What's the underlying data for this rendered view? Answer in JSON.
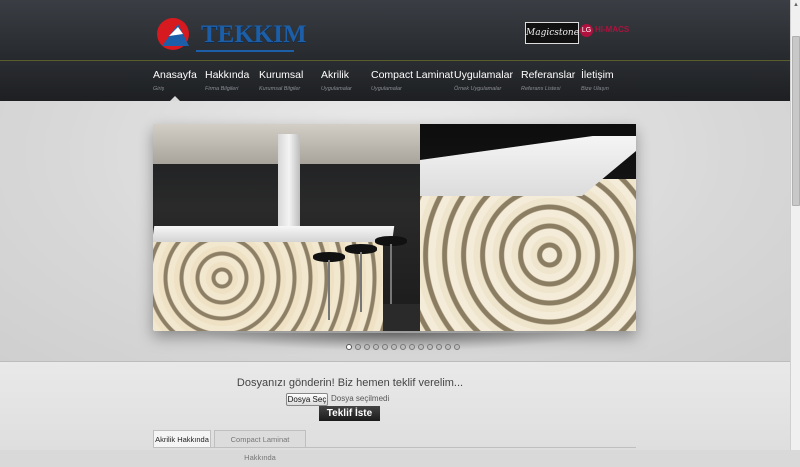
{
  "header": {
    "logo_text": "TEKKIM",
    "partner_logo_1": "Magicstone",
    "partner_logo_2_mark": "LG",
    "partner_logo_2_text": "HI-MACS"
  },
  "nav": {
    "items": [
      {
        "label": "Anasayfa",
        "sub": "Giriş"
      },
      {
        "label": "Hakkında",
        "sub": "Firma Bilgileri"
      },
      {
        "label": "Kurumsal",
        "sub": "Kurumsal Bilgiler"
      },
      {
        "label": "Akrilik",
        "sub": "Uygulamalar"
      },
      {
        "label": "Compact Laminat",
        "sub": "Uygulamalar"
      },
      {
        "label": "Uygulamalar",
        "sub": "Örnek Uygulamalar"
      },
      {
        "label": "Referanslar",
        "sub": "Referans Listesi"
      },
      {
        "label": "İletişim",
        "sub": "Bize Ulaşın"
      }
    ],
    "active_index": 0
  },
  "slider": {
    "slide_count": 13,
    "active_slide": 1
  },
  "upload": {
    "prompt": "Dosyanızı gönderin! Biz hemen teklif verelim...",
    "choose_file_label": "Dosya Seç",
    "file_status": "Dosya seçilmedi",
    "submit_label": "Teklif İste"
  },
  "tabs": [
    {
      "label": "Akrilik Hakkında",
      "active": true
    },
    {
      "label": "Compact Laminat Hakkında",
      "active": false
    }
  ],
  "colors": {
    "brand_blue": "#1c5fa8",
    "brand_red": "#d71920",
    "nav_bg": "#1d1f22",
    "nav_accent_line": "#5a5e2a",
    "hi_macs_red": "#b0103d"
  }
}
